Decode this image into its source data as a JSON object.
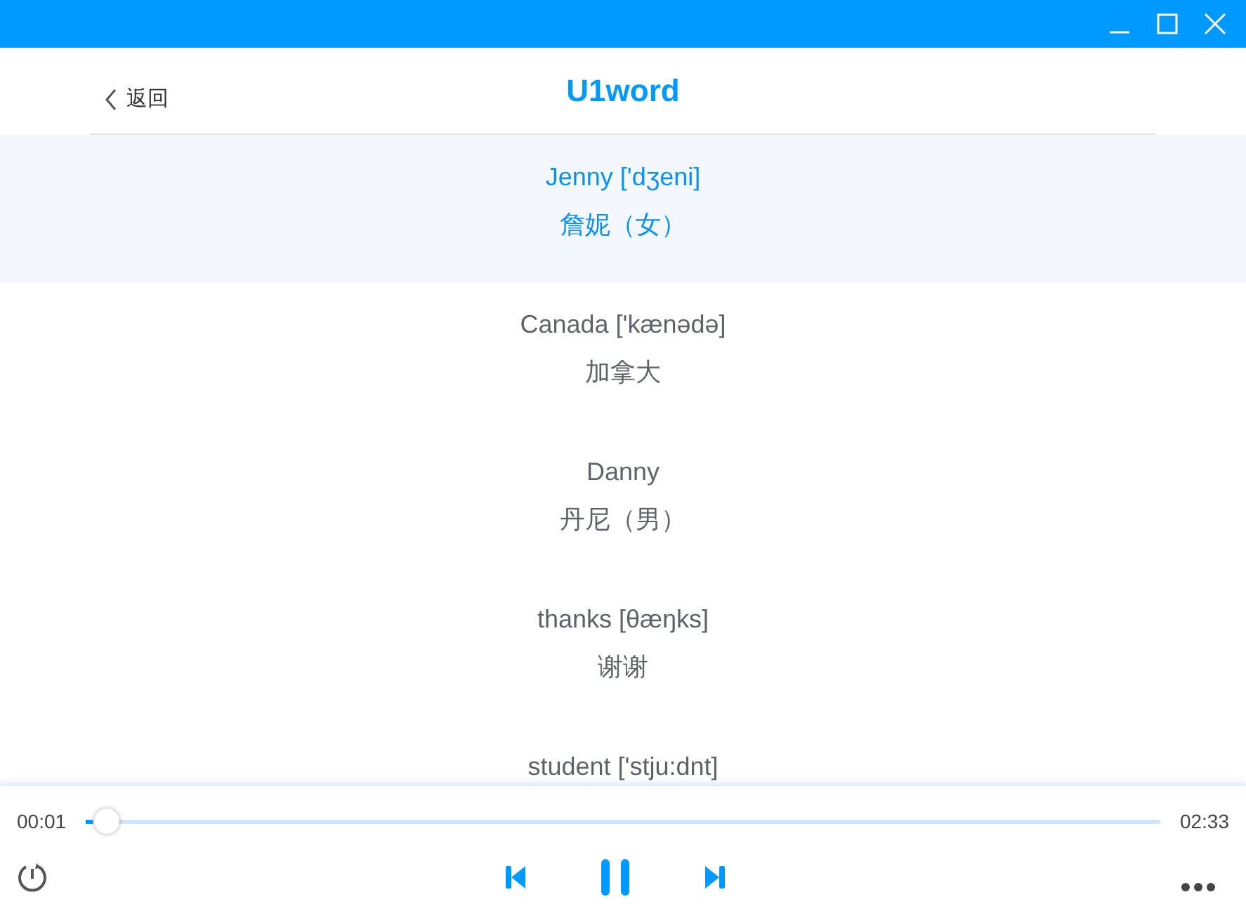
{
  "header": {
    "back": "返回",
    "title": "U1word"
  },
  "words": [
    {
      "word": "Jenny ['dʒeni]",
      "meaning": "詹妮（女）",
      "selected": true
    },
    {
      "word": "Canada ['kænədə]",
      "meaning": "加拿大",
      "selected": false
    },
    {
      "word": "Danny",
      "meaning": "丹尼（男）",
      "selected": false
    },
    {
      "word": "thanks [θæŋks]",
      "meaning": "谢谢",
      "selected": false
    },
    {
      "word": "student ['stju:dnt]",
      "selected": false
    }
  ],
  "player": {
    "current": "00:01",
    "total": "02:33",
    "level": 0.007
  }
}
